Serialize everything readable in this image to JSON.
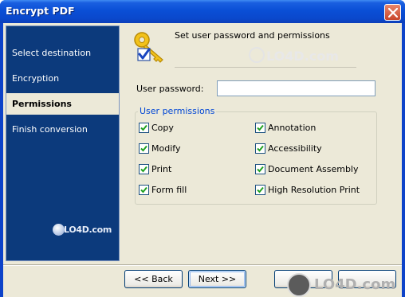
{
  "window": {
    "title": "Encrypt PDF"
  },
  "sidebar": {
    "items": [
      {
        "label": "Select destination"
      },
      {
        "label": "Encryption"
      },
      {
        "label": "Permissions"
      },
      {
        "label": "Finish conversion"
      }
    ],
    "active_index": 2,
    "logo_text": "LO4D.com"
  },
  "page": {
    "heading": "Set user password and permissions",
    "password_label": "User password:",
    "password_value": ""
  },
  "permissions": {
    "group_title": "User permissions",
    "items": [
      {
        "label": "Copy",
        "checked": true
      },
      {
        "label": "Annotation",
        "checked": true
      },
      {
        "label": "Modify",
        "checked": true
      },
      {
        "label": "Accessibility",
        "checked": true
      },
      {
        "label": "Print",
        "checked": true
      },
      {
        "label": "Document Assembly",
        "checked": true
      },
      {
        "label": "Form fill",
        "checked": true
      },
      {
        "label": "High Resolution Print",
        "checked": true
      }
    ]
  },
  "buttons": {
    "back": "<< Back",
    "next": "Next >>"
  },
  "watermark": {
    "text": "LO4D.com"
  },
  "icons": {
    "title_close": "close-icon",
    "header": "key-checkmark-icon"
  },
  "colors": {
    "titlebar": "#0a4fd6",
    "sidebar": "#0c3a7c",
    "group_title": "#0046d5",
    "dialog_bg": "#ece9d8"
  }
}
